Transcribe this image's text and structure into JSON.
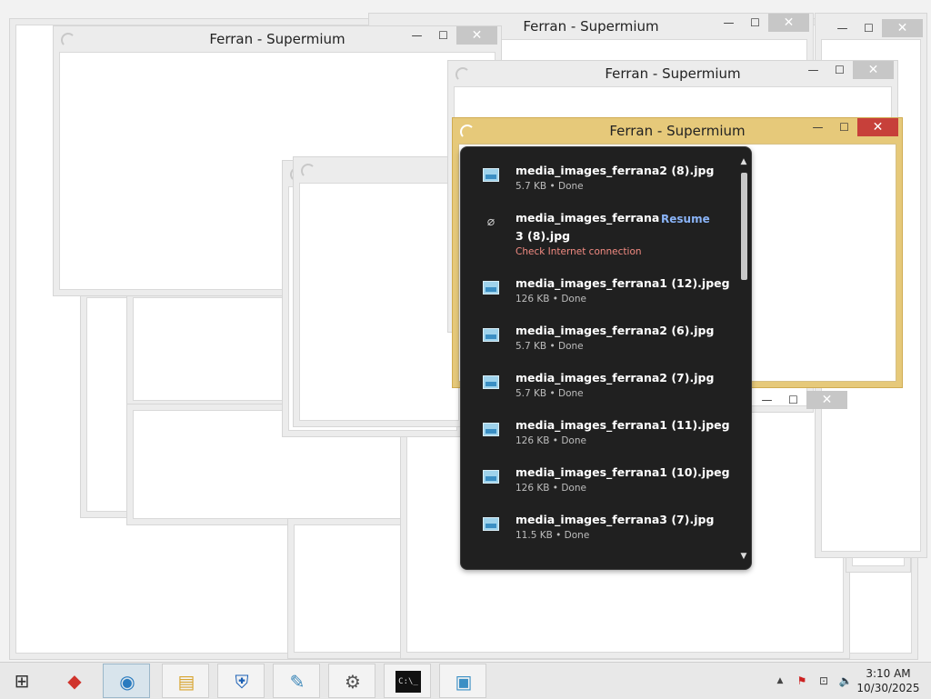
{
  "windows": {
    "title": "Ferran - Supermium",
    "min_glyph": "—",
    "max_glyph": "☐",
    "close_glyph": "✕"
  },
  "downloads": {
    "items": [
      {
        "name": "media_images_ferrana2 (8).jpg",
        "status": "5.7 KB • Done"
      },
      {
        "name_line1": "media_images_ferrana",
        "name_line2": "3 (8).jpg",
        "status": "Check Internet connection",
        "action": "Resume"
      },
      {
        "name": "media_images_ferrana1 (12).jpeg",
        "status": "126 KB • Done"
      },
      {
        "name": "media_images_ferrana2 (6).jpg",
        "status": "5.7 KB • Done"
      },
      {
        "name": "media_images_ferrana2 (7).jpg",
        "status": "5.7 KB • Done"
      },
      {
        "name": "media_images_ferrana1 (11).jpeg",
        "status": "126 KB • Done"
      },
      {
        "name": "media_images_ferrana1 (10).jpeg",
        "status": "126 KB • Done"
      },
      {
        "name": "media_images_ferrana3 (7).jpg",
        "status": "11.5 KB • Done"
      }
    ]
  },
  "taskbar": {
    "apps": [
      {
        "icon": "windows-start-icon",
        "glyph": "⊞"
      },
      {
        "icon": "web-app-icon",
        "glyph": "◆"
      },
      {
        "icon": "supermium-browser-icon",
        "glyph": "◉"
      },
      {
        "icon": "file-explorer-icon",
        "glyph": "▤"
      },
      {
        "icon": "windows-defender-icon",
        "glyph": "⛨"
      },
      {
        "icon": "notepad-icon",
        "glyph": "✎"
      },
      {
        "icon": "settings-tool-icon",
        "glyph": "⚙"
      },
      {
        "icon": "command-prompt-icon",
        "glyph": "C:\\_"
      },
      {
        "icon": "image-viewer-icon",
        "glyph": "▣"
      }
    ],
    "tray": {
      "chevron": "▲",
      "flag": "⚑",
      "network": "⊡",
      "volume": "🔈"
    },
    "time": "3:10 AM",
    "date": "10/30/2025"
  },
  "colors": {
    "active_frame": "#e6c97a",
    "close_active": "#c7403a",
    "panel_bg": "#202020",
    "link": "#8ab4f8",
    "error": "#f28b82"
  }
}
